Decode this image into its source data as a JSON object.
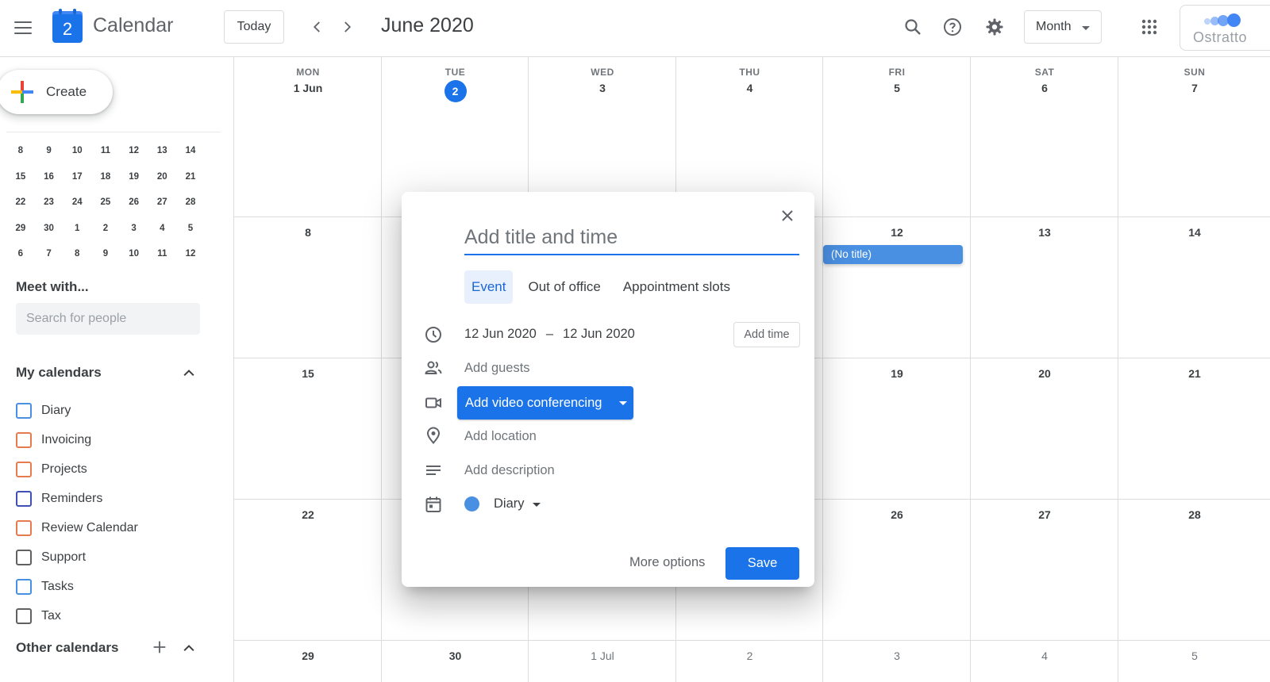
{
  "header": {
    "logo_day": "2",
    "app_title": "Calendar",
    "today_label": "Today",
    "current_period": "June 2020",
    "view_label": "Month",
    "account_brand": "Ostratto",
    "icons": [
      "menu-icon",
      "chevron-left-icon",
      "chevron-right-icon",
      "search-icon",
      "help-icon",
      "settings-icon",
      "apps-grid-icon"
    ]
  },
  "sidebar": {
    "create_label": "Create",
    "mini_calendar": {
      "weeks": [
        [
          "8",
          "9",
          "10",
          "11",
          "12",
          "13",
          "14"
        ],
        [
          "15",
          "16",
          "17",
          "18",
          "19",
          "20",
          "21"
        ],
        [
          "22",
          "23",
          "24",
          "25",
          "26",
          "27",
          "28"
        ],
        [
          "29",
          "30",
          "1",
          "2",
          "3",
          "4",
          "5"
        ],
        [
          "6",
          "7",
          "8",
          "9",
          "10",
          "11",
          "12"
        ]
      ]
    },
    "meet_title": "Meet with...",
    "search_placeholder": "Search for people",
    "my_calendars_title": "My calendars",
    "my_calendars": [
      {
        "label": "Diary",
        "color": "#4a90e2"
      },
      {
        "label": "Invoicing",
        "color": "#e67c4d"
      },
      {
        "label": "Projects",
        "color": "#e67c4d"
      },
      {
        "label": "Reminders",
        "color": "#3f51b5"
      },
      {
        "label": "Review Calendar",
        "color": "#e67c4d"
      },
      {
        "label": "Support",
        "color": "#616161"
      },
      {
        "label": "Tasks",
        "color": "#4a90e2"
      },
      {
        "label": "Tax",
        "color": "#616161"
      }
    ],
    "other_calendars_title": "Other calendars"
  },
  "grid": {
    "day_headers": [
      {
        "dow": "MON",
        "date": "1 Jun"
      },
      {
        "dow": "TUE",
        "date": "2",
        "today": true
      },
      {
        "dow": "WED",
        "date": "3"
      },
      {
        "dow": "THU",
        "date": "4"
      },
      {
        "dow": "FRI",
        "date": "5"
      },
      {
        "dow": "SAT",
        "date": "6"
      },
      {
        "dow": "SUN",
        "date": "7"
      }
    ],
    "weeks": [
      [
        "8",
        "",
        "",
        "",
        "12",
        "13",
        "14"
      ],
      [
        "15",
        "",
        "",
        "",
        "19",
        "20",
        "21"
      ],
      [
        "22",
        "",
        "",
        "",
        "26",
        "27",
        "28"
      ],
      [
        "29",
        "30",
        "1 Jul",
        "2",
        "3",
        "4",
        "5"
      ]
    ],
    "event_chip": "(No title)"
  },
  "dialog": {
    "title_placeholder": "Add title and time",
    "tabs": [
      "Event",
      "Out of office",
      "Appointment slots"
    ],
    "start_date": "12 Jun 2020",
    "date_separator": "–",
    "end_date": "12 Jun 2020",
    "add_time_label": "Add time",
    "add_guests": "Add guests",
    "video_label": "Add video conferencing",
    "add_location": "Add location",
    "add_description": "Add description",
    "calendar_name": "Diary",
    "more_options": "More options",
    "save_label": "Save"
  }
}
